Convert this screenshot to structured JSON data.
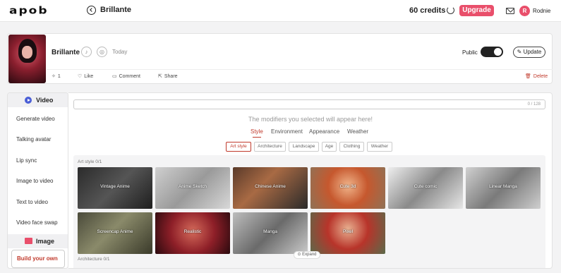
{
  "topbar": {
    "logo": "apob",
    "title": "Brillante",
    "credits": "60 credits",
    "upgrade": "Upgrade",
    "avatar_letter": "R",
    "username": "Rodnie"
  },
  "project": {
    "name": "Brillante",
    "date": "Today",
    "public_label": "Public",
    "public_on": true,
    "update": "Update",
    "likes_count": "1",
    "like": "Like",
    "comment": "Comment",
    "share": "Share",
    "delete": "Delete"
  },
  "sidebar": {
    "video_head": "Video",
    "items": [
      "Generate video",
      "Talking avatar",
      "Lip sync",
      "Image to video",
      "Text to video",
      "Video face swap"
    ],
    "image_head": "Image",
    "build": "Build your own"
  },
  "main": {
    "char_count": "0 / 128",
    "hint": "The modifiers you selected will appear here!",
    "tabs": [
      "Style",
      "Environment",
      "Appearance",
      "Weather"
    ],
    "chips": [
      "Art style",
      "Architecture",
      "Landscape",
      "Age",
      "Clothing",
      "Weather"
    ],
    "section_art": "Art style   0/1",
    "section_arch": "Architecture   0/1",
    "tiles": [
      "Vintage Anime",
      "Anime Sketch",
      "Chinese Anime",
      "Cute 3d",
      "Cute comic",
      "Linear Manga",
      "Screencap Anime",
      "Realistic",
      "Manga",
      "Pixel"
    ],
    "expand": "Expand"
  },
  "colors": {
    "accent": "#e94f6b",
    "active_tab": "#c0392b",
    "video_icon": "#4a5ed6"
  }
}
